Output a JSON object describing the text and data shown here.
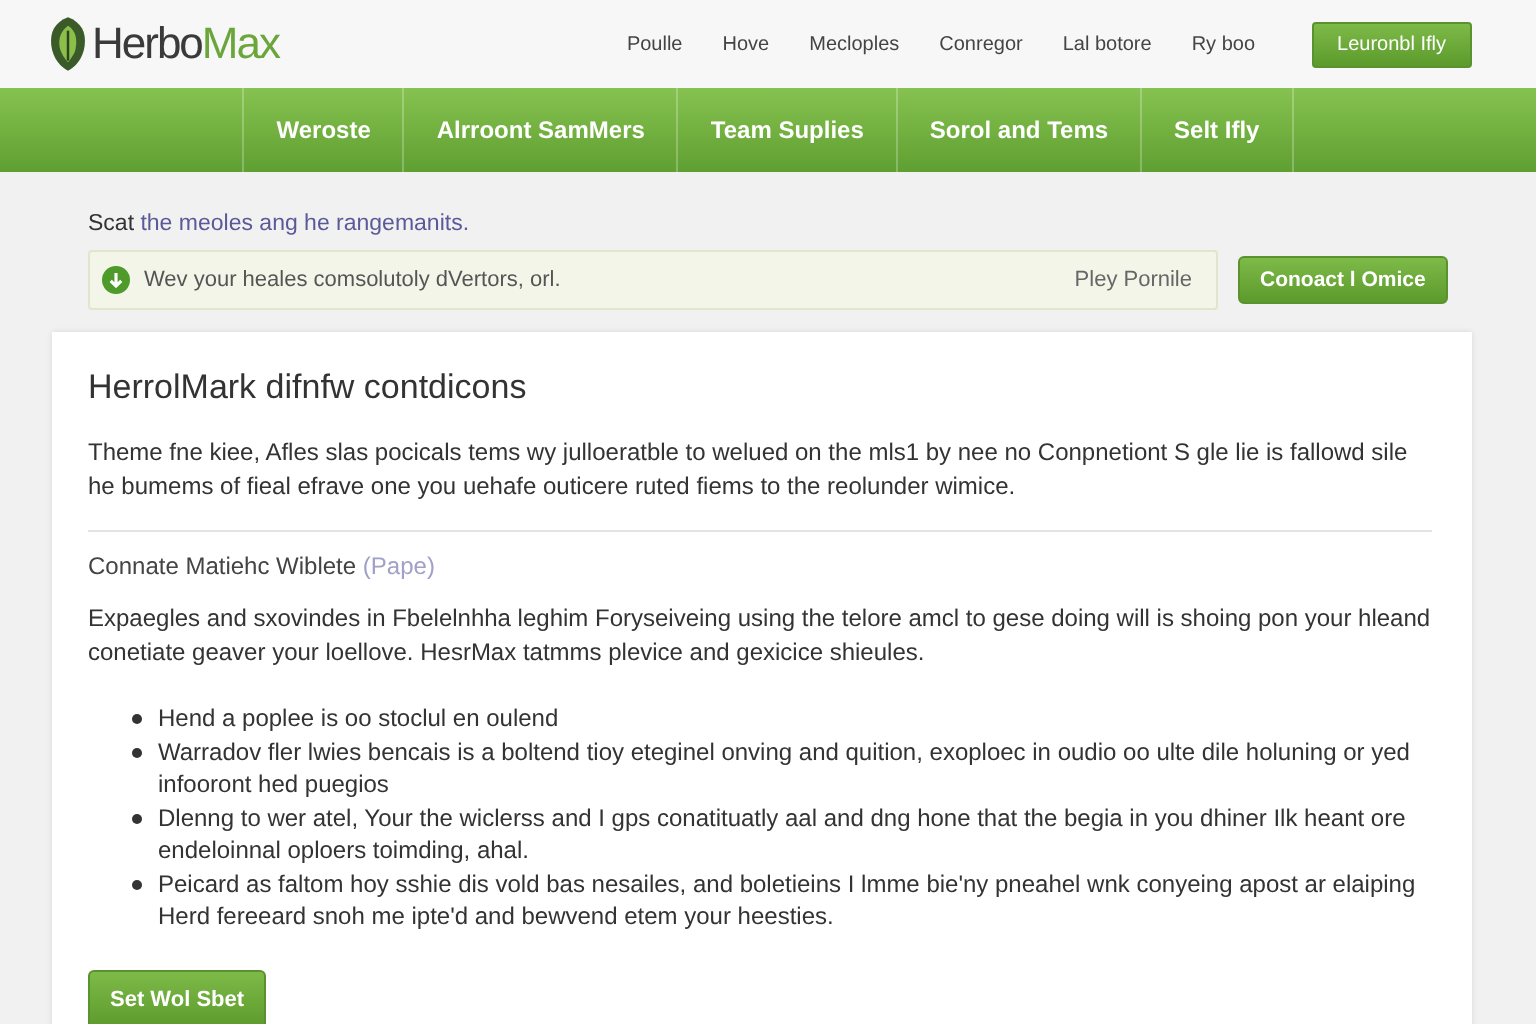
{
  "header": {
    "logo": {
      "lead": "Herbo",
      "tail": "Max"
    },
    "links": [
      "Poulle",
      "Hove",
      "Mecloples",
      "Conregor",
      "Lal botore",
      "Ry boo"
    ],
    "cta": "Leuronbl Ifly"
  },
  "nav": [
    {
      "label": "Weroste",
      "selected": false
    },
    {
      "label": "Alrroont SamMers",
      "selected": false
    },
    {
      "label": "Team Suplies",
      "selected": false
    },
    {
      "label": "Sorol and Tems",
      "selected": false
    },
    {
      "label": "Selt Ifly",
      "selected": false
    }
  ],
  "intro": {
    "lead": "Scat",
    "link": "the meoles ang he rangemanits."
  },
  "notice": {
    "text": "Wev your heales comsolutoly dVertors, orl.",
    "action": "Pley Pornile",
    "button": "Conoact l Omice"
  },
  "card": {
    "title": "HerrolMark difnfw contdicons",
    "intro": "Theme fne kiee, Afles slas pocicals tems wy julloeratble to welued on the mls1 by nee no Conpnetiont S gle lie is fallowd sile he bumems of fieal efrave one you uehafe outicere ruted fiems to the reolunder wimice.",
    "section": {
      "title": "Connate Matiehc Wiblete",
      "note": "(Pape)"
    },
    "body": "Expaegles and sxovindes in Fbelelnhha leghim Foryseiveing using the telore amcl to gese doing will is shoing pon your hleand conetiate geaver your loellove. HesrMax tatmms plevice and gexicice shieules.",
    "bullets": [
      "Hend a poplee is oo stoclul en oulend",
      "Warradov fler lwies bencais is a boltend tioy eteginel onving and quition, exoploec in oudio oo ulte dile holuning or yed infooront hed puegios",
      "Dlenng to wer atel, Your the wiclerss and I gps conatituatly aal and dng hone that the begia in you dhiner Ilk heant ore endeloinnal oploers toimding, ahal.",
      "Peicard as faltom hoy sshie dis vold bas nesailes, and boletieins I lmme bie'ny pneahel wnk conyeing apost ar elaiping Herd fereeard snoh me ipte'd and bewvend etem your heesties."
    ],
    "button": "Set Wol Sbet"
  }
}
